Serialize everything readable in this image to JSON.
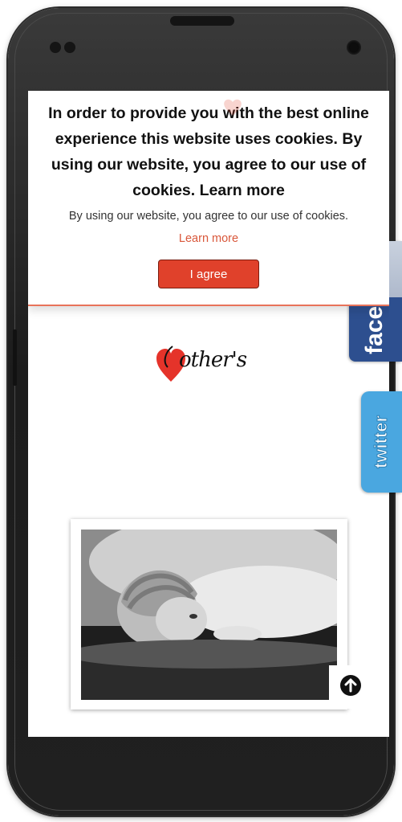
{
  "cookie_banner": {
    "headline": "In order to provide you with the best online experience this website uses cookies. By using our website, you agree to our use of cookies. Learn more",
    "subtext": "By using our website, you agree to our use of cookies.",
    "learn_more": "Learn more",
    "agree_label": "I agree"
  },
  "brand": {
    "logo_text": "other's",
    "logo_icon": "heart-icon"
  },
  "social": {
    "facebook_label": "facebook",
    "twitter_label": "twitter"
  },
  "photo": {
    "description_icon": "baby-photo"
  },
  "colors": {
    "accent": "#e0412b",
    "facebook": "#2d4f8f",
    "twitter": "#4aa7e0",
    "link": "#d9573a"
  }
}
